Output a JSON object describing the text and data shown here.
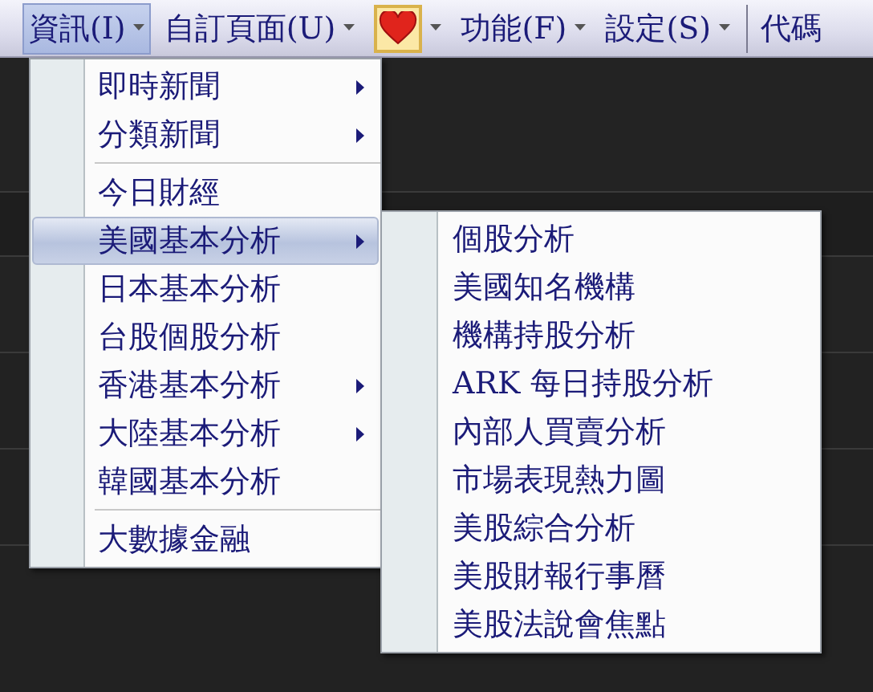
{
  "menubar": [
    {
      "kind": "text",
      "label": "資訊(I)",
      "selected": true,
      "dropdown": true
    },
    {
      "kind": "text",
      "label": "自訂頁面(U)",
      "selected": false,
      "dropdown": true
    },
    {
      "kind": "favorite",
      "selected": false,
      "dropdown": true
    },
    {
      "kind": "text",
      "label": "功能(F)",
      "selected": false,
      "dropdown": true
    },
    {
      "kind": "text",
      "label": "設定(S)",
      "selected": false,
      "dropdown": true
    },
    {
      "kind": "separator"
    },
    {
      "kind": "text",
      "label": "代碼",
      "selected": false,
      "dropdown": false
    }
  ],
  "menu": [
    {
      "kind": "item",
      "label": "即時新聞",
      "submenu": true,
      "selected": false
    },
    {
      "kind": "item",
      "label": "分類新聞",
      "submenu": true,
      "selected": false
    },
    {
      "kind": "separator"
    },
    {
      "kind": "item",
      "label": "今日財經",
      "submenu": false,
      "selected": false
    },
    {
      "kind": "item",
      "label": "美國基本分析",
      "submenu": true,
      "selected": true
    },
    {
      "kind": "item",
      "label": "日本基本分析",
      "submenu": false,
      "selected": false
    },
    {
      "kind": "item",
      "label": "台股個股分析",
      "submenu": false,
      "selected": false
    },
    {
      "kind": "item",
      "label": "香港基本分析",
      "submenu": true,
      "selected": false
    },
    {
      "kind": "item",
      "label": "大陸基本分析",
      "submenu": true,
      "selected": false
    },
    {
      "kind": "item",
      "label": "韓國基本分析",
      "submenu": false,
      "selected": false
    },
    {
      "kind": "separator"
    },
    {
      "kind": "item",
      "label": "大數據金融",
      "submenu": false,
      "selected": false
    }
  ],
  "submenu": [
    {
      "label": "個股分析"
    },
    {
      "label": "美國知名機構"
    },
    {
      "label": "機構持股分析"
    },
    {
      "label": "ARK 每日持股分析"
    },
    {
      "label": "內部人買賣分析"
    },
    {
      "label": "市場表現熱力圖"
    },
    {
      "label": "美股綜合分析"
    },
    {
      "label": "美股財報行事曆"
    },
    {
      "label": "美股法說會焦點"
    }
  ]
}
